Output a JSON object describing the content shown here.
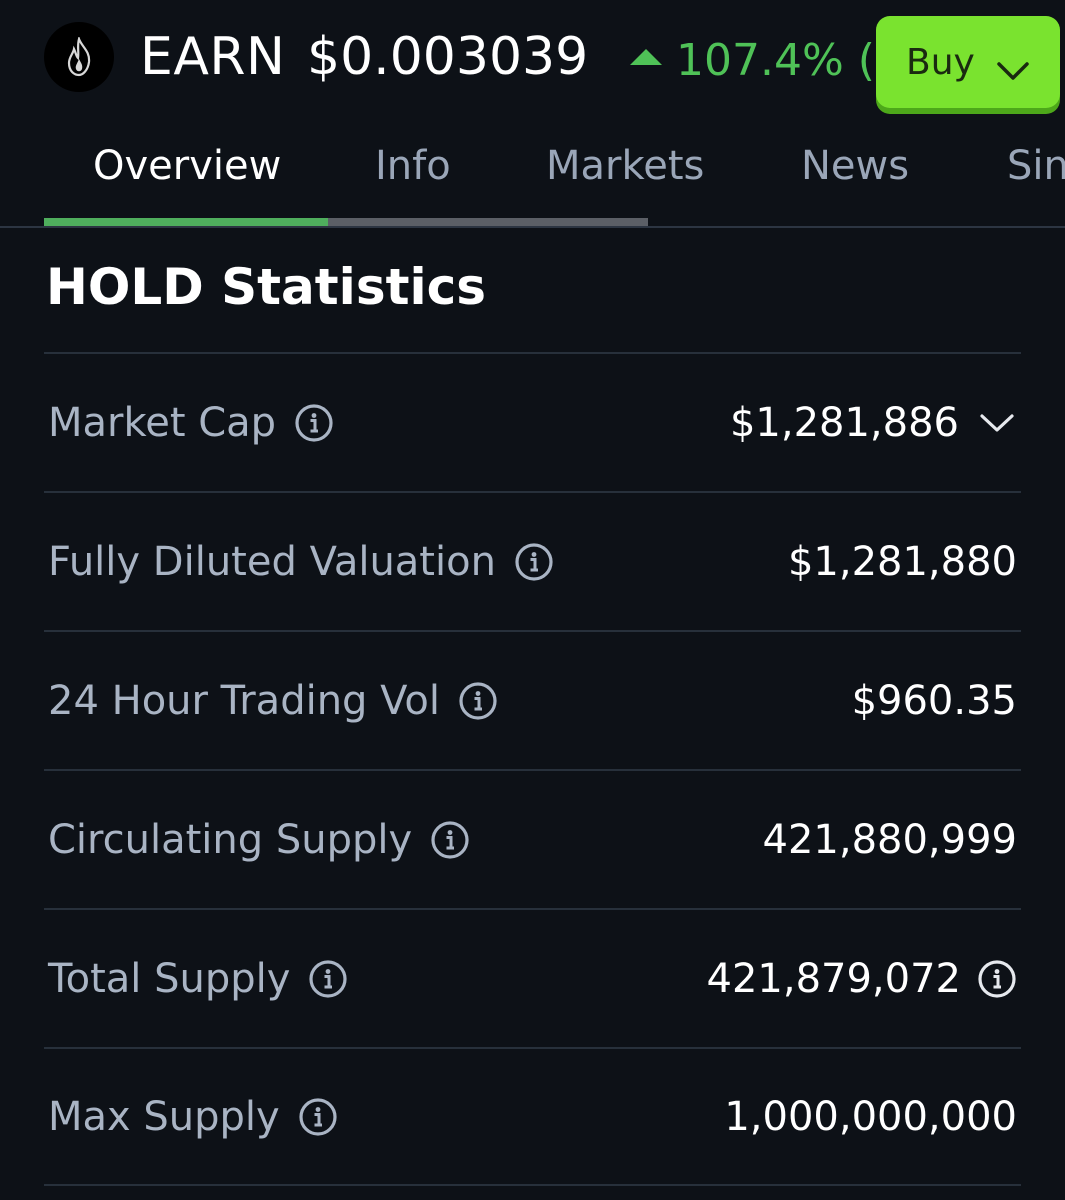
{
  "header": {
    "coin_logo_icon": "flame-icon",
    "ticker": "EARN",
    "price": "$0.003039",
    "change_percent": "107.4% (",
    "change_direction": "up",
    "buy_label": "Buy",
    "colors": {
      "positive": "#4fc257",
      "buy_button": "#7ae32f"
    }
  },
  "tabs": [
    {
      "label": "Overview",
      "active": true
    },
    {
      "label": "Info",
      "active": false
    },
    {
      "label": "Markets",
      "active": false
    },
    {
      "label": "News",
      "active": false
    },
    {
      "label": "Sin",
      "active": false
    }
  ],
  "stats": {
    "title": "HOLD Statistics",
    "rows": [
      {
        "label": "Market Cap",
        "value": "$1,281,886",
        "value_icon": "chevron-down-icon"
      },
      {
        "label": "Fully Diluted Valuation",
        "value": "$1,281,880",
        "value_icon": ""
      },
      {
        "label": "24 Hour Trading Vol",
        "value": "$960.35",
        "value_icon": ""
      },
      {
        "label": "Circulating Supply",
        "value": "421,880,999",
        "value_icon": ""
      },
      {
        "label": "Total Supply",
        "value": "421,879,072",
        "value_icon": "info-icon"
      },
      {
        "label": "Max Supply",
        "value": "1,000,000,000",
        "value_icon": ""
      }
    ]
  }
}
